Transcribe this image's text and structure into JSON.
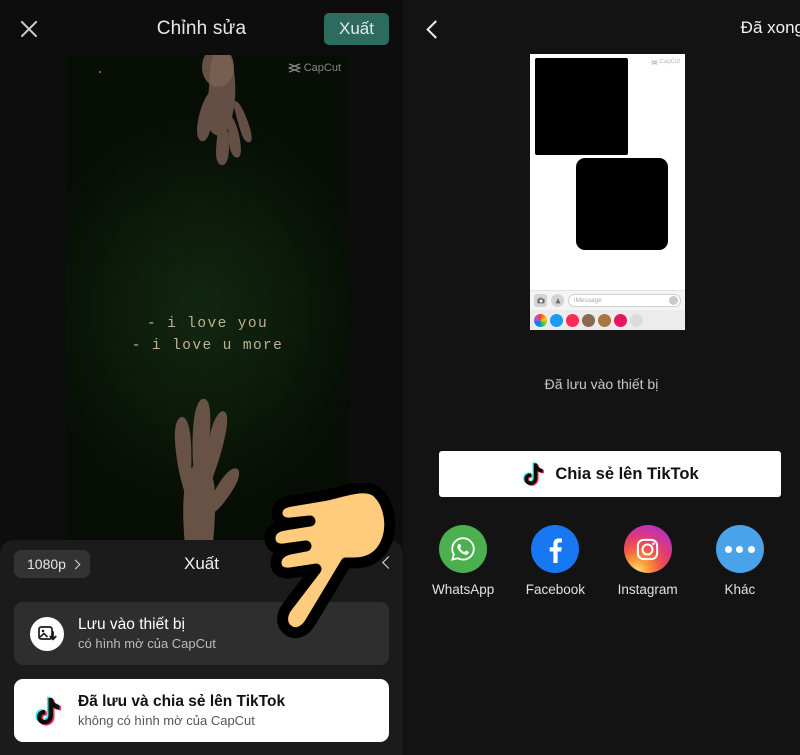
{
  "left_panel": {
    "topbar": {
      "close_icon": "close-icon",
      "title": "Chỉnh sửa",
      "export_label": "Xuất"
    },
    "video": {
      "watermark": "CapCut",
      "subtitle_line1": "- i love you",
      "subtitle_line2": "- i love u more"
    },
    "sheet": {
      "resolution_label": "1080p",
      "title": "Xuất",
      "options": [
        {
          "icon": "save-to-device-icon",
          "title": "Lưu vào thiết bị",
          "subtitle": "có hình mờ của CapCut"
        },
        {
          "icon": "tiktok-icon",
          "title": "Đã lưu và chia sẻ lên TikTok",
          "subtitle": "không có hình mờ của CapCut"
        }
      ]
    }
  },
  "right_panel": {
    "topbar": {
      "back_icon": "chevron-left-icon",
      "done_label": "Đã xong"
    },
    "preview": {
      "watermark": "CapCut",
      "imessage_placeholder": "iMessage"
    },
    "saved_text": "Đã lưu vào thiết bị",
    "share_button": {
      "icon": "tiktok-icon",
      "label": "Chia sẻ lên TikTok"
    },
    "social_targets": [
      {
        "icon": "whatsapp-icon",
        "label": "WhatsApp"
      },
      {
        "icon": "facebook-icon",
        "label": "Facebook"
      },
      {
        "icon": "instagram-icon",
        "label": "Instagram"
      },
      {
        "icon": "more-icon",
        "label": "Khác"
      }
    ]
  },
  "cursors": [
    {
      "name": "pointing-hand-cursor-left"
    },
    {
      "name": "pointing-hand-cursor-right"
    }
  ],
  "colors": {
    "export_green": "#2f6a5e",
    "sheet_bg": "#1b1b1b",
    "card_dark": "#2e2e2e",
    "whatsapp": "#4caf50",
    "facebook": "#1877f2",
    "more_blue": "#4aa3e8",
    "tiktok_cyan": "#25f4ee",
    "tiktok_pink": "#fe2c55"
  }
}
